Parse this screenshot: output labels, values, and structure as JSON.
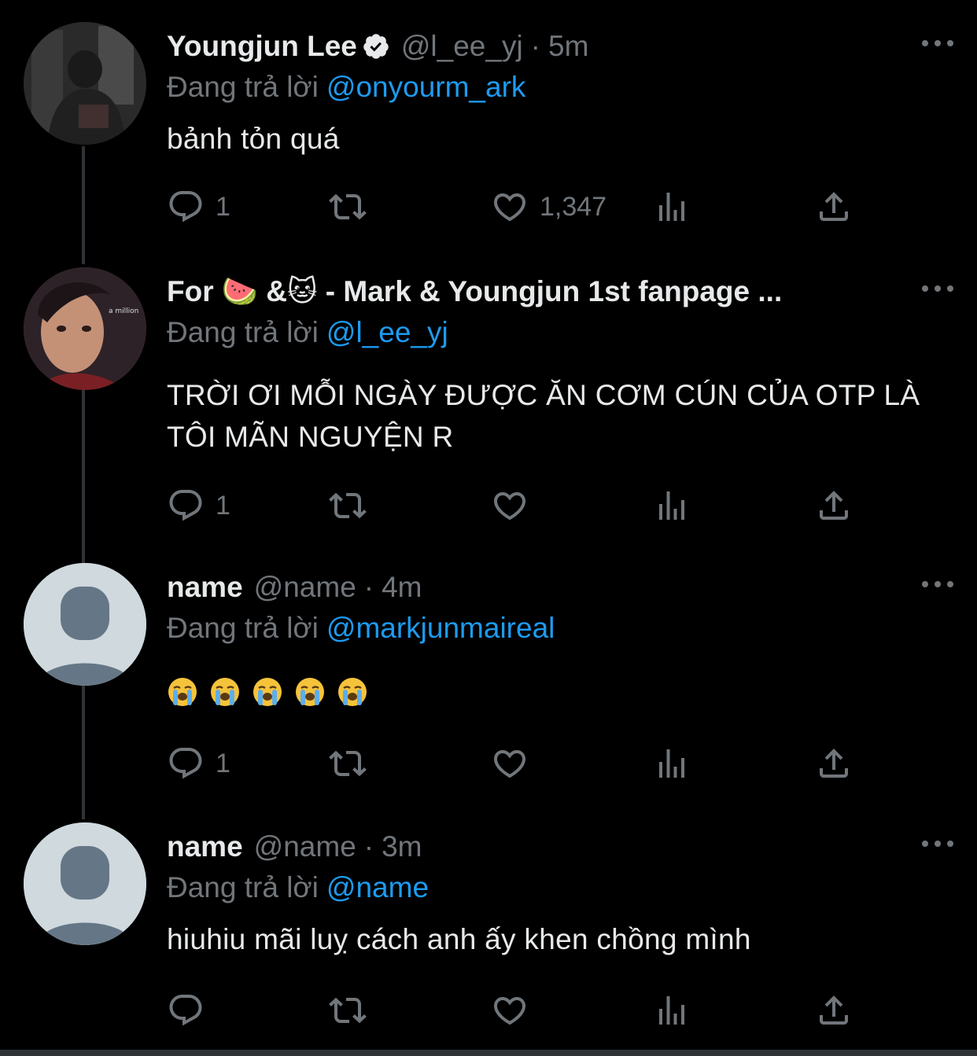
{
  "colors": {
    "background": "#000000",
    "text": "#e7e9ea",
    "muted": "#71767b",
    "link": "#1d9bf0",
    "line": "#2f3336"
  },
  "tweets": [
    {
      "display_name": "Youngjun Lee",
      "verified": true,
      "handle": "@l_ee_yj",
      "dot": "·",
      "time": "5m",
      "reply_prefix": "Đang trả lời",
      "reply_to": "@onyourm_ark",
      "text": "bảnh tỏn quá",
      "reply_count": "1",
      "like_count": "1,347",
      "avatar": "photo-avatar"
    },
    {
      "display_name": "For 🍉 &🐱 - Mark & Youngjun 1st fanpage ...",
      "handle": "",
      "reply_prefix": "Đang trả lời",
      "reply_to": "@l_ee_yj",
      "text": "TRỜI ƠI MỖI NGÀY ĐƯỢC ĂN CƠM CÚN CỦA OTP LÀ TÔI MÃN NGUYỆN R",
      "reply_count": "1",
      "like_count": "",
      "avatar": "photo-avatar"
    },
    {
      "display_name": "name",
      "handle": "@name",
      "dot": "·",
      "time": "4m",
      "reply_prefix": "Đang trả lời",
      "reply_to": "@markjunmaireal",
      "emoji_name": "loudly-crying-face",
      "reply_count": "1",
      "like_count": "",
      "avatar": "default-avatar"
    },
    {
      "display_name": "name",
      "handle": "@name",
      "dot": "·",
      "time": "3m",
      "reply_prefix": "Đang trả lời",
      "reply_to": "@name",
      "text": "hiuhiu mãi luỵ cách anh ấy khen chồng mình",
      "reply_count": "",
      "like_count": "",
      "avatar": "default-avatar"
    }
  ]
}
